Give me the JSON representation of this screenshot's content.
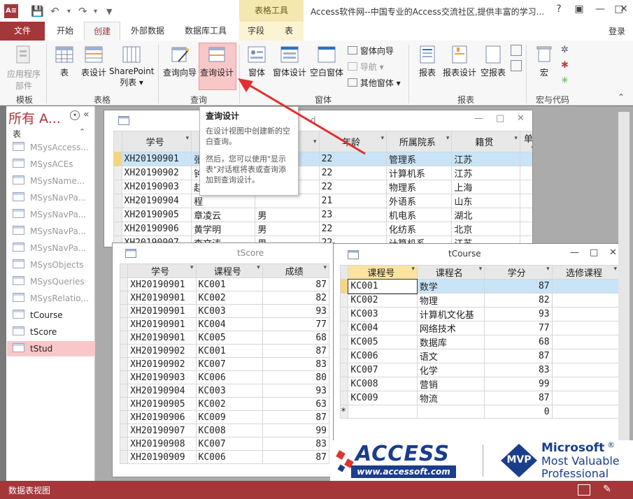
{
  "titlebar": {
    "app_icon": "A≡",
    "context_group": "表格工具",
    "window_title": "Access软件网--中国专业的Access交流社区,提供丰富的学习...",
    "help": "?"
  },
  "tabs": [
    "文件",
    "开始",
    "创建",
    "外部数据",
    "数据库工具",
    "字段",
    "表"
  ],
  "login": "登录",
  "ribbon": {
    "buttons": {
      "app_parts": "应用程序部件",
      "table": "表",
      "table_design": "表设计",
      "sharepoint_lists": "SharePoint 列表",
      "query_wizard": "查询向导",
      "query_design": "查询设计",
      "form": "窗体",
      "form_design": "窗体设计",
      "blank_form": "空白窗体",
      "form_wizard": "窗体向导",
      "navigation": "导航",
      "more_forms": "其他窗体",
      "report": "报表",
      "report_design": "报表设计",
      "blank_report": "空报表",
      "macro": "宏"
    },
    "groups": [
      "模板",
      "表格",
      "查询",
      "窗体",
      "报表",
      "宏与代码"
    ]
  },
  "nav": {
    "title": "所有 A...",
    "section": "表",
    "items": [
      {
        "label": "MSysAccess...",
        "user": false
      },
      {
        "label": "MSysACEs",
        "user": false
      },
      {
        "label": "MSysName...",
        "user": false
      },
      {
        "label": "MSysNavPa...",
        "user": false
      },
      {
        "label": "MSysNavPa...",
        "user": false
      },
      {
        "label": "MSysNavPa...",
        "user": false
      },
      {
        "label": "MSysNavPa...",
        "user": false
      },
      {
        "label": "MSysObjects",
        "user": false
      },
      {
        "label": "MSysQueries",
        "user": false
      },
      {
        "label": "MSysRelatio...",
        "user": false
      },
      {
        "label": "tCourse",
        "user": true
      },
      {
        "label": "tScore",
        "user": true
      },
      {
        "label": "tStud",
        "user": true,
        "selected": true
      }
    ]
  },
  "tooltip": {
    "title": "查询设计",
    "line1": "在设计视图中创建新的空白查询。",
    "line2": "然后，您可以使用\"显示表\"对话框将表或查询添加到查询设计。"
  },
  "tstud": {
    "title": "d",
    "columns": [
      "学号",
      "",
      "",
      "年龄",
      "所属院系",
      "籍贯",
      "单"
    ],
    "rows": [
      [
        "XH20190901",
        "张",
        "",
        "22",
        "管理系",
        "江苏"
      ],
      [
        "XH20190902",
        "钟",
        "",
        "22",
        "计算机系",
        "江苏"
      ],
      [
        "XH20190903",
        "赵",
        "",
        "22",
        "物理系",
        "上海"
      ],
      [
        "XH20190904",
        "程",
        "",
        "21",
        "外语系",
        "山东"
      ],
      [
        "XH20190905",
        "章凌云",
        "男",
        "23",
        "机电系",
        "湖北"
      ],
      [
        "XH20190906",
        "黄学明",
        "男",
        "22",
        "化纺系",
        "北京"
      ],
      [
        "XH20190907",
        "李文涛",
        "男",
        "22",
        "计算机系",
        "江苏"
      ]
    ]
  },
  "tscore": {
    "title": "tScore",
    "columns": [
      "学号",
      "课程号",
      "成绩"
    ],
    "rows": [
      [
        "XH20190901",
        "KC001",
        "87"
      ],
      [
        "XH20190901",
        "KC002",
        "82"
      ],
      [
        "XH20190901",
        "KC003",
        "93"
      ],
      [
        "XH20190901",
        "KC004",
        "77"
      ],
      [
        "XH20190901",
        "KC005",
        "68"
      ],
      [
        "XH20190902",
        "KC001",
        "87"
      ],
      [
        "XH20190902",
        "KC007",
        "83"
      ],
      [
        "XH20190903",
        "KC006",
        "80"
      ],
      [
        "XH20190904",
        "KC003",
        "93"
      ],
      [
        "XH20190905",
        "KC002",
        "63"
      ],
      [
        "XH20190906",
        "KC009",
        "87"
      ],
      [
        "XH20190907",
        "KC008",
        "99"
      ],
      [
        "XH20190908",
        "KC007",
        "83"
      ],
      [
        "XH20190909",
        "KC006",
        "87"
      ]
    ]
  },
  "tcourse": {
    "title": "tCourse",
    "columns": [
      "课程号",
      "课程名",
      "学分",
      "选修课程"
    ],
    "rows": [
      [
        "KC001",
        "数学",
        "87",
        ""
      ],
      [
        "KC002",
        "物理",
        "82",
        ""
      ],
      [
        "KC003",
        "计算机文化基",
        "93",
        ""
      ],
      [
        "KC004",
        "网络技术",
        "77",
        ""
      ],
      [
        "KC005",
        "数据库",
        "68",
        ""
      ],
      [
        "KC006",
        "语文",
        "87",
        ""
      ],
      [
        "KC007",
        "化学",
        "83",
        ""
      ],
      [
        "KC008",
        "营销",
        "99",
        ""
      ],
      [
        "KC009",
        "物流",
        "87",
        ""
      ]
    ],
    "new_row_marker": "*",
    "new_row_value": "0"
  },
  "logo": {
    "brand": "ACCESS",
    "url": "www.accessoft.com",
    "mvp": "MVP",
    "ms_line1": "Microsoft",
    "ms_line2": "Most Valuable",
    "ms_line3": "Professional",
    "reg": "®"
  },
  "status": {
    "text": "数据表视图"
  },
  "colors": {
    "accent": "#a4373a",
    "selection_pink": "#f8c7c8",
    "row_highlight": "#c9e3f7",
    "context_gold": "#f5e7b0"
  }
}
